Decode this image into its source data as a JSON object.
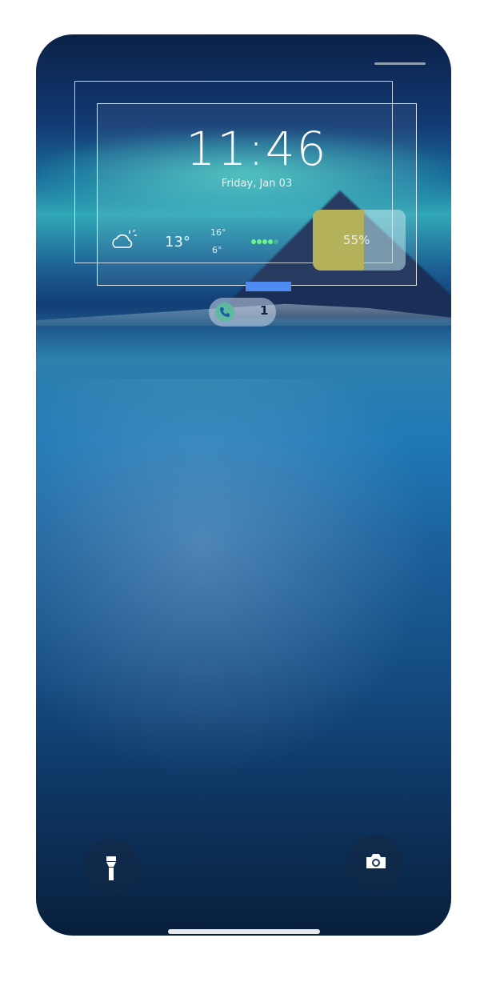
{
  "lockscreen": {
    "time": "11:46",
    "date": "Friday, Jan 03",
    "weather": {
      "icon": "partly-cloudy-icon",
      "current_temp": "13°",
      "high": "16°",
      "low": "6°"
    },
    "signal_dots": 5,
    "battery": {
      "label": "55%",
      "level": 0.55,
      "fill_color": "#b3b25a"
    },
    "notification": {
      "icon": "phone-call-icon",
      "count": "1"
    },
    "shortcuts": {
      "left": "flashlight-icon",
      "right": "camera-icon"
    }
  },
  "colors": {
    "accent_blue": "#4e8cf2",
    "signal_green": "#6cf38a"
  }
}
